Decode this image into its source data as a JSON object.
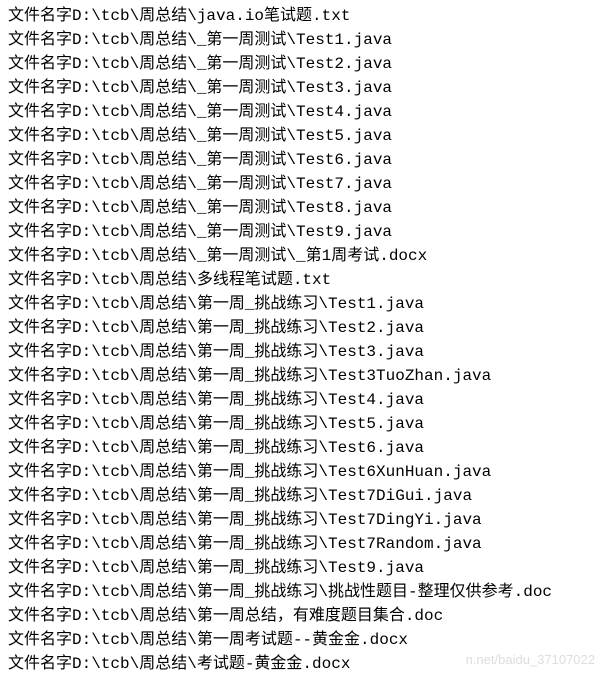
{
  "prefix": "文件名字",
  "lines": [
    "D:\\tcb\\周总结\\java.io笔试题.txt",
    "D:\\tcb\\周总结\\_第一周测试\\Test1.java",
    "D:\\tcb\\周总结\\_第一周测试\\Test2.java",
    "D:\\tcb\\周总结\\_第一周测试\\Test3.java",
    "D:\\tcb\\周总结\\_第一周测试\\Test4.java",
    "D:\\tcb\\周总结\\_第一周测试\\Test5.java",
    "D:\\tcb\\周总结\\_第一周测试\\Test6.java",
    "D:\\tcb\\周总结\\_第一周测试\\Test7.java",
    "D:\\tcb\\周总结\\_第一周测试\\Test8.java",
    "D:\\tcb\\周总结\\_第一周测试\\Test9.java",
    "D:\\tcb\\周总结\\_第一周测试\\_第1周考试.docx",
    "D:\\tcb\\周总结\\多线程笔试题.txt",
    "D:\\tcb\\周总结\\第一周_挑战练习\\Test1.java",
    "D:\\tcb\\周总结\\第一周_挑战练习\\Test2.java",
    "D:\\tcb\\周总结\\第一周_挑战练习\\Test3.java",
    "D:\\tcb\\周总结\\第一周_挑战练习\\Test3TuoZhan.java",
    "D:\\tcb\\周总结\\第一周_挑战练习\\Test4.java",
    "D:\\tcb\\周总结\\第一周_挑战练习\\Test5.java",
    "D:\\tcb\\周总结\\第一周_挑战练习\\Test6.java",
    "D:\\tcb\\周总结\\第一周_挑战练习\\Test6XunHuan.java",
    "D:\\tcb\\周总结\\第一周_挑战练习\\Test7DiGui.java",
    "D:\\tcb\\周总结\\第一周_挑战练习\\Test7DingYi.java",
    "D:\\tcb\\周总结\\第一周_挑战练习\\Test7Random.java",
    "D:\\tcb\\周总结\\第一周_挑战练习\\Test9.java",
    "D:\\tcb\\周总结\\第一周_挑战练习\\挑战性题目-整理仅供参考.doc",
    "D:\\tcb\\周总结\\第一周总结，有难度题目集合.doc",
    "D:\\tcb\\周总结\\第一周考试题--黄金金.docx",
    "D:\\tcb\\周总结\\考试题-黄金金.docx"
  ],
  "watermark": "n.net/baidu_37107022"
}
